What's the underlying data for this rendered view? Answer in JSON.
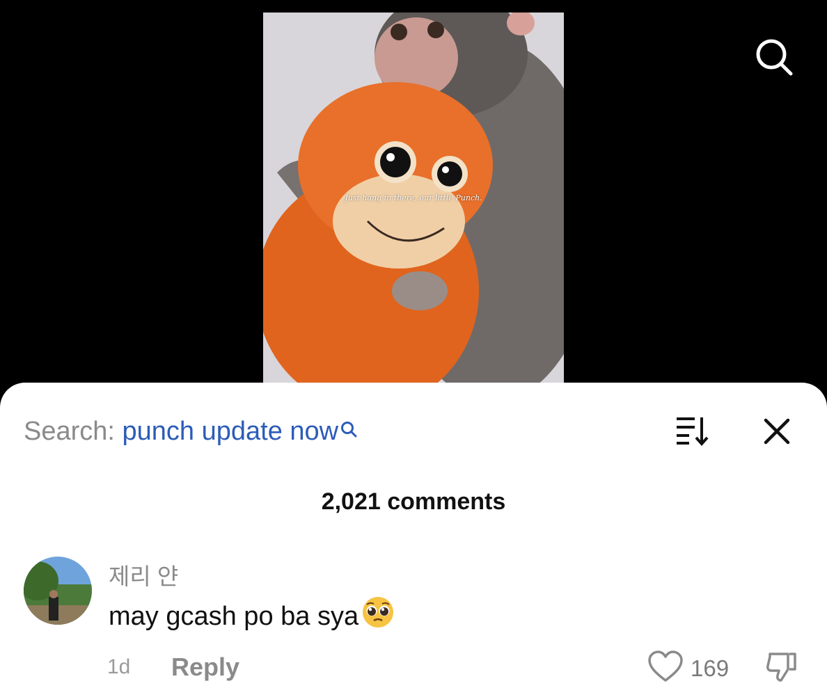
{
  "video": {
    "caption": "Just hang in there, our little Punch."
  },
  "top_search_icon": "search-icon",
  "sheet": {
    "search_label": "Search:",
    "search_query": "punch update now",
    "sort_icon": "sort-icon",
    "close_icon": "close-icon",
    "comment_count": "2,021 comments"
  },
  "comment": {
    "username": "제리 얀",
    "text": "may gcash po ba sya",
    "emoji": "pleading-face",
    "age": "1d",
    "reply_label": "Reply",
    "like_count": "169"
  },
  "colors": {
    "query_blue": "#2c5cb8",
    "gray_text": "#8a8a8a"
  }
}
